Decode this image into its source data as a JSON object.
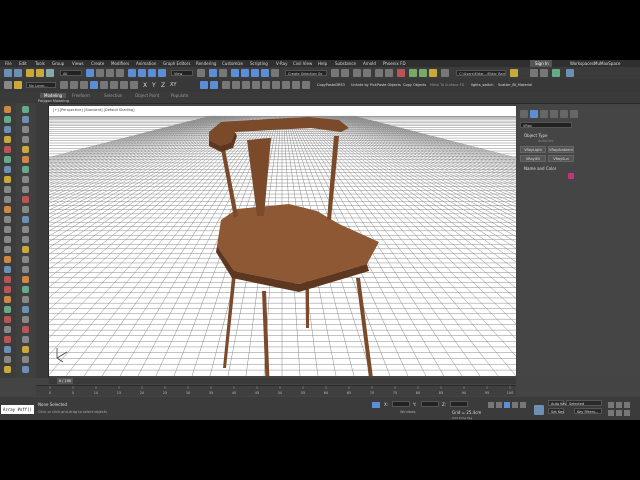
{
  "menubar": {
    "items": [
      "File",
      "Edit",
      "Tools",
      "Group",
      "Views",
      "Create",
      "Modifiers",
      "Animation",
      "Graph Editors",
      "Rendering",
      "Customize",
      "Scripting",
      "V-Ray",
      "Civil View",
      "Help",
      "Substance",
      "Arnold",
      "Phoenix FD"
    ],
    "sign_in": "Sign In",
    "workspaces_label": "Workspaces:",
    "workspace_value": "MuMaxSpace"
  },
  "toolbar1": {
    "selection_filter": "All",
    "view_dropdown": "View",
    "named_selection": "Create Selection Se",
    "project_path": "C:\\Users\\Eldar...\\Eldar Ram..."
  },
  "toolbar2": {
    "layer": "No Layer...",
    "axis_labels": [
      "X",
      "Y",
      "Z",
      "XY"
    ],
    "scripts": [
      "CopyPasteDRE3",
      "Unhide by Pick",
      "Paste Objects",
      "Copy Objects",
      "Mesh To Surface FG",
      "lights_switch",
      "Scatter_Bt_Material"
    ]
  },
  "ribbon": {
    "tabs": [
      "Modeling",
      "Freeform",
      "Selection",
      "Object Paint",
      "Populate"
    ],
    "active_tab": "Modeling",
    "subtitle": "Polygon Modeling"
  },
  "viewport": {
    "label": "[+] [Perspective] [Standard] [Default Shading]",
    "background": "#ffffff",
    "grid_color": "#8a8a8a",
    "chair_color": "#7a4a2a",
    "chair_shade": "#5e3720",
    "chair_light": "#8e5834"
  },
  "command_panel": {
    "rollout_object_type": "Object Type",
    "autogrid": "AutoGrid",
    "buttons": [
      "VRayLight",
      "VRayAmbient",
      "VRayIES",
      "VRaySun"
    ],
    "rollout_name_color": "Name and Color",
    "category": "VRay",
    "swatch_color": "#c8307a"
  },
  "timeslider": {
    "frame": "0 / 100"
  },
  "trackbar": {
    "ticks": [
      "0",
      "5",
      "10",
      "15",
      "20",
      "25",
      "30",
      "35",
      "40",
      "45",
      "50",
      "55",
      "60",
      "65",
      "70",
      "75",
      "80",
      "85",
      "90",
      "95",
      "100"
    ]
  },
  "statusbar": {
    "maxscript": "Array #off()",
    "selection_status": "None Selected",
    "prompt": "Click or click-and-drag to select objects",
    "x_label": "X:",
    "y_label": "Y:",
    "z_label": "Z:",
    "grid": "Grid = 25.4cm",
    "add_time_tag": "Add Time Tag",
    "isolate": "Windows",
    "auto_key": "Auto Key",
    "auto_key_value": "Selected",
    "set_key": "Set Key",
    "key_filters": "Key Filters..."
  }
}
